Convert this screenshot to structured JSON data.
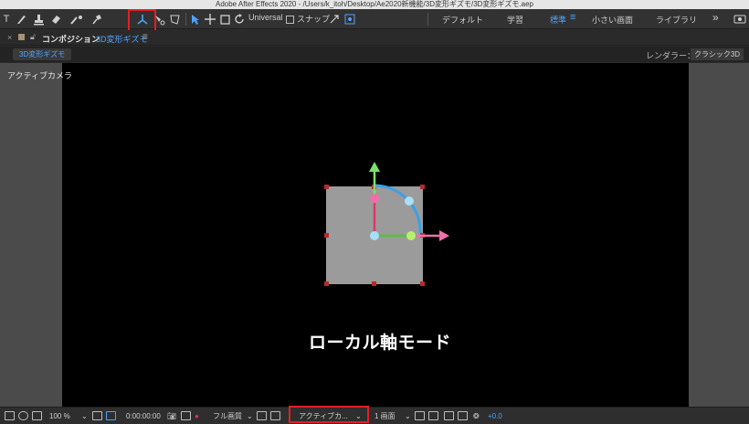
{
  "window": {
    "title": "Adobe After Effects 2020 - /Users/k_itoh/Desktop/Ae2020新機能/3D変形ギズモ/3D変形ギズモ.aep"
  },
  "toolbar": {
    "axis_mode_label": "Universal",
    "snap_label": "スナップ",
    "workspaces": [
      "デフォルト",
      "学習",
      "標準",
      "小さい画面",
      "ライブラリ"
    ],
    "active_workspace": "標準",
    "highlight_color": "#e41e25"
  },
  "panel": {
    "close": "×",
    "title": "コンポジション",
    "comp_name": "3D変形ギズモ",
    "menu_icon": "≡",
    "comp_tab": "3D変形ギズモ",
    "renderer_label": "レンダラー：",
    "renderer_value": "クラシック3D"
  },
  "viewer": {
    "camera_label": "アクティブカメラ",
    "caption": "ローカル軸モード",
    "layer_color": "#9b9b9b",
    "handle_color": "#b82a2a",
    "x_axis_color": "#f06fa9",
    "y_axis_color": "#7ee06a",
    "z_axis_color": "#3aa0e8"
  },
  "bottom": {
    "zoom": "100 %",
    "timecode": "0:00:00:00",
    "resolution": "フル画質",
    "view": "アクティブカ...",
    "views_count": "1 画面",
    "exposure": "+0.0"
  }
}
